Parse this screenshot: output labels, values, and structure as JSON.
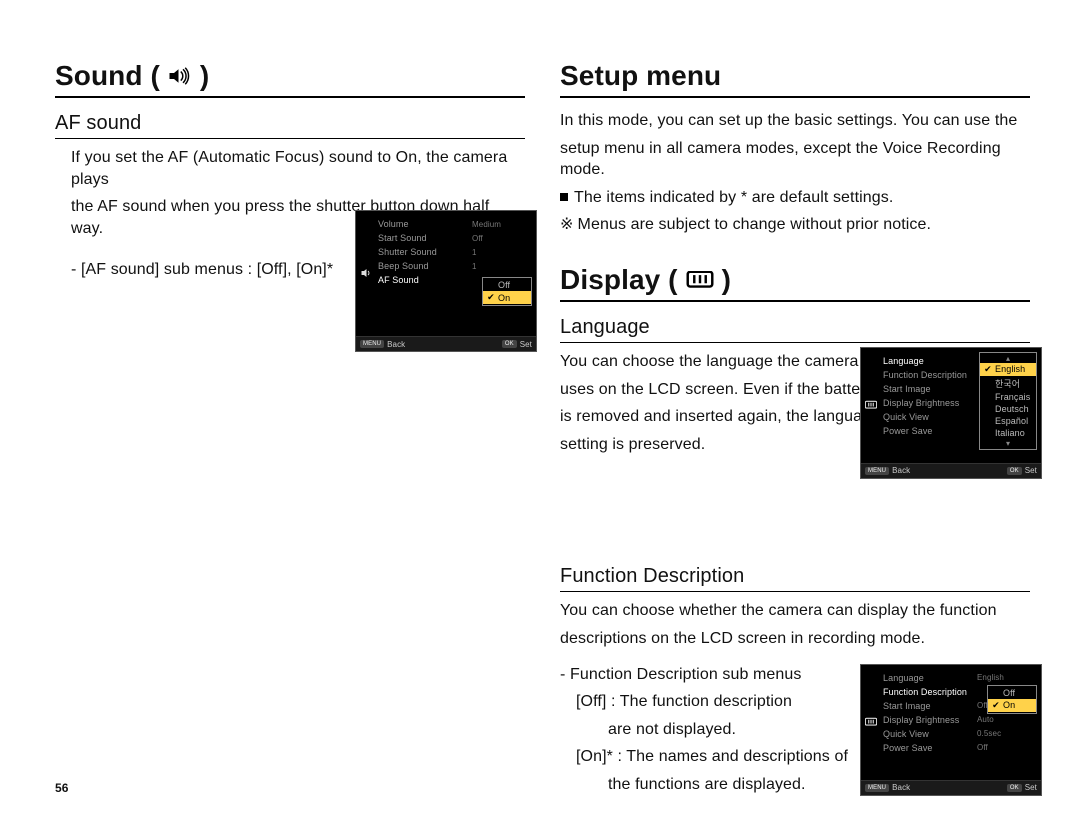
{
  "page_number": "56",
  "left": {
    "heading": "Sound (",
    "heading_close": " )",
    "af": {
      "title": "AF sound",
      "p1a": "If you set the AF (Automatic Focus) sound to On, the camera plays",
      "p1b": "the AF sound when you press the shutter button down half way.",
      "sub": "- [AF sound] sub menus : [Off], [On]*"
    },
    "cam1": {
      "rows": [
        {
          "k": "Volume",
          "v": "Medium"
        },
        {
          "k": "Start Sound",
          "v": "Off"
        },
        {
          "k": "Shutter Sound",
          "v": "1"
        },
        {
          "k": "Beep Sound",
          "v": "1"
        },
        {
          "k": "AF Sound",
          "v": ""
        }
      ],
      "popup": {
        "off": "Off",
        "on": "On"
      },
      "bar": {
        "back_key": "MENU",
        "back": "Back",
        "set_key": "OK",
        "set": "Set"
      }
    }
  },
  "right": {
    "setup": {
      "heading": "Setup menu",
      "p1a": "In this mode, you can set up the basic settings. You can use the",
      "p1b": "setup menu in all camera modes, except the Voice Recording mode.",
      "p2": "The items indicated by * are default settings.",
      "p3": "Menus are subject to change without prior notice."
    },
    "display": {
      "heading": "Display (",
      "heading_close": " )",
      "lang": {
        "title": "Language",
        "p1a": "You can choose the language the camera",
        "p1b": "uses on the LCD screen. Even if the battery",
        "p1c": "is removed and inserted again, the language",
        "p1d": "setting is preserved."
      },
      "cam2": {
        "rows": [
          {
            "k": "Language",
            "v": ""
          },
          {
            "k": "Function Description",
            "v": ""
          },
          {
            "k": "Start Image",
            "v": ""
          },
          {
            "k": "Display Brightness",
            "v": ""
          },
          {
            "k": "Quick View",
            "v": ""
          },
          {
            "k": "Power Save",
            "v": ""
          }
        ],
        "langs": [
          "English",
          "한국어",
          "Français",
          "Deutsch",
          "Español",
          "Italiano"
        ],
        "bar": {
          "back_key": "MENU",
          "back": "Back",
          "set_key": "OK",
          "set": "Set"
        }
      },
      "fd": {
        "title": "Function Description",
        "p1a": "You can choose whether the camera can display the function",
        "p1b": "descriptions on the LCD screen in recording mode.",
        "sub": "- Function Description sub menus",
        "off1": "[Off]  : The function description",
        "off2": "are not displayed.",
        "on1": "[On]* : The names and descriptions of",
        "on2": "the functions are displayed."
      },
      "cam3": {
        "rows": [
          {
            "k": "Language",
            "v": "English"
          },
          {
            "k": "Function Description",
            "v": ""
          },
          {
            "k": "Start Image",
            "v": "Off"
          },
          {
            "k": "Display Brightness",
            "v": "Auto"
          },
          {
            "k": "Quick View",
            "v": "0.5sec"
          },
          {
            "k": "Power Save",
            "v": "Off"
          }
        ],
        "popup": {
          "off": "Off",
          "on": "On"
        },
        "bar": {
          "back_key": "MENU",
          "back": "Back",
          "set_key": "OK",
          "set": "Set"
        }
      }
    }
  }
}
